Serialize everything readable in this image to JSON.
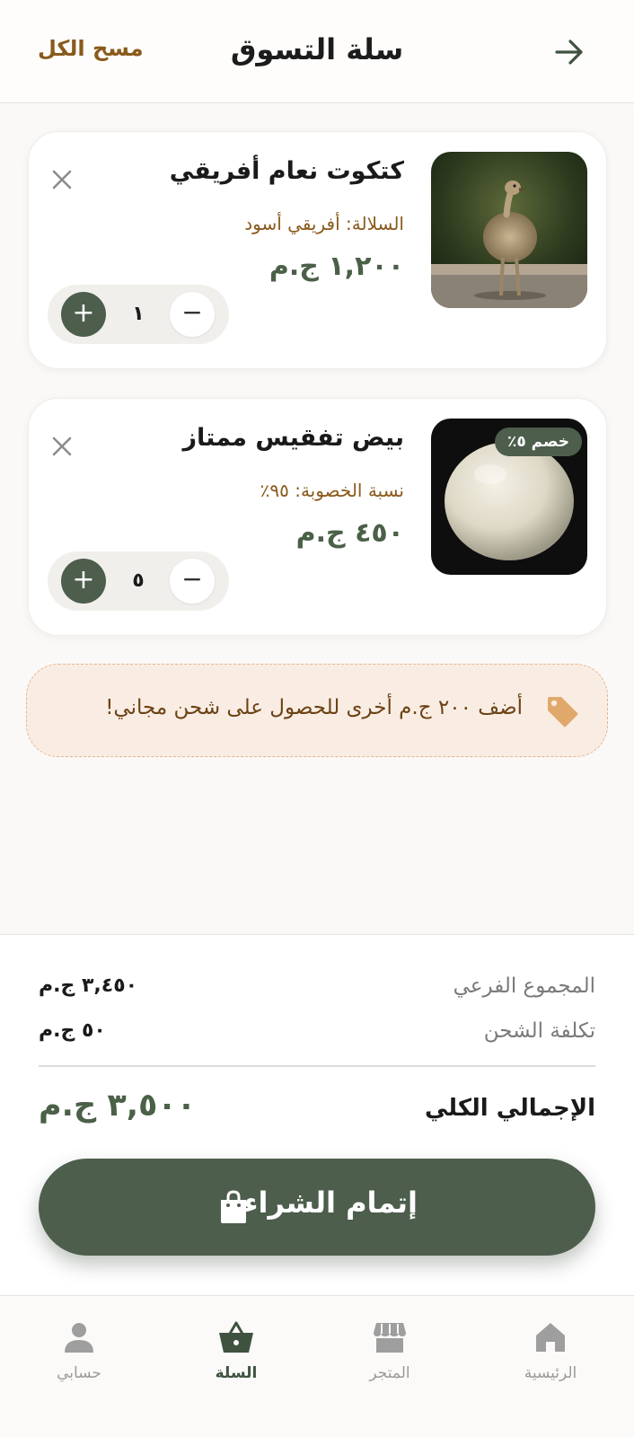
{
  "header": {
    "title": "سلة التسوق",
    "clear_all_label": "مسح الكل",
    "back_icon": "arrow-right-icon"
  },
  "cart": {
    "items": [
      {
        "title": "كتكوت نعام أفريقي",
        "subtitle": "السلالة: أفريقي أسود",
        "price": "١,٢٠٠ ج.م",
        "quantity": "١",
        "image": "ostrich-chick-photo"
      },
      {
        "title": "بيض تفقيس ممتاز",
        "subtitle": "نسبة الخصوبة: ٩٥٪",
        "price": "٤٥٠ ج.م",
        "quantity": "٥",
        "badge": "خصم ٥٪",
        "image": "ostrich-egg-photo"
      }
    ]
  },
  "promo": {
    "text": "أضف ٢٠٠ ج.م أخرى للحصول على شحن مجاني!",
    "icon": "tag-icon"
  },
  "summary": {
    "subtotal_label": "المجموع الفرعي",
    "subtotal_value": "٣,٤٥٠ ج.م",
    "shipping_label": "تكلفة الشحن",
    "shipping_value": "٥٠ ج.م",
    "total_label": "الإجمالي الكلي",
    "total_value": "٣,٥٠٠ ج.م",
    "checkout_label": "إتمام الشراء"
  },
  "nav": {
    "home": "الرئيسية",
    "store": "المتجر",
    "cart": "السلة",
    "account": "حسابي",
    "active": "cart"
  },
  "colors": {
    "primary": "#4d5e4c",
    "accent_brown": "#8a5a1c",
    "promo_bg": "#f9ede3",
    "tag": "#e0a86a"
  }
}
